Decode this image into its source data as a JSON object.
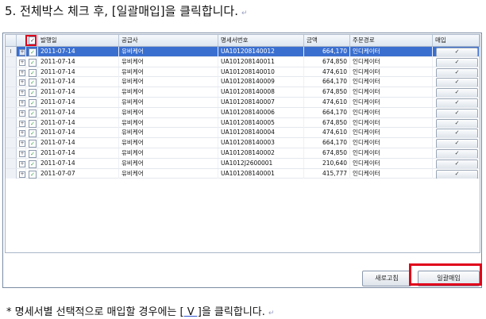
{
  "heading": {
    "text": "5. 전체박스 체크 후, [일괄매입]을 클릭합니다.",
    "mark": "↵"
  },
  "grid": {
    "columns": [
      "",
      "",
      "✓",
      "발행일",
      "공급사",
      "명세서번호",
      "금액",
      "주문경로",
      "매입"
    ],
    "rows": [
      {
        "indicator": "I",
        "expand": "+",
        "check": "✓",
        "date": "2011-07-14",
        "supplier": "유비케어",
        "statement": "UA101208140012",
        "amount": "664,170",
        "route": "인디케이터",
        "buy": "✓"
      },
      {
        "indicator": "",
        "expand": "+",
        "check": "✓",
        "date": "2011-07-14",
        "supplier": "유비케어",
        "statement": "UA101208140011",
        "amount": "674,850",
        "route": "인디케이터",
        "buy": "✓"
      },
      {
        "indicator": "",
        "expand": "+",
        "check": "✓",
        "date": "2011-07-14",
        "supplier": "유비케어",
        "statement": "UA101208140010",
        "amount": "474,610",
        "route": "인디케이터",
        "buy": "✓"
      },
      {
        "indicator": "",
        "expand": "+",
        "check": "✓",
        "date": "2011-07-14",
        "supplier": "유비케어",
        "statement": "UA101208140009",
        "amount": "664,170",
        "route": "인디케이터",
        "buy": "✓"
      },
      {
        "indicator": "",
        "expand": "+",
        "check": "✓",
        "date": "2011-07-14",
        "supplier": "유비케어",
        "statement": "UA101208140008",
        "amount": "674,850",
        "route": "인디케이터",
        "buy": "✓"
      },
      {
        "indicator": "",
        "expand": "+",
        "check": "✓",
        "date": "2011-07-14",
        "supplier": "유비케어",
        "statement": "UA101208140007",
        "amount": "474,610",
        "route": "인디케이터",
        "buy": "✓"
      },
      {
        "indicator": "",
        "expand": "+",
        "check": "✓",
        "date": "2011-07-14",
        "supplier": "유비케어",
        "statement": "UA101208140006",
        "amount": "664,170",
        "route": "인디케이터",
        "buy": "✓"
      },
      {
        "indicator": "",
        "expand": "+",
        "check": "✓",
        "date": "2011-07-14",
        "supplier": "유비케어",
        "statement": "UA101208140005",
        "amount": "674,850",
        "route": "인디케이터",
        "buy": "✓"
      },
      {
        "indicator": "",
        "expand": "+",
        "check": "✓",
        "date": "2011-07-14",
        "supplier": "유비케어",
        "statement": "UA101208140004",
        "amount": "474,610",
        "route": "인디케이터",
        "buy": "✓"
      },
      {
        "indicator": "",
        "expand": "+",
        "check": "✓",
        "date": "2011-07-14",
        "supplier": "유비케어",
        "statement": "UA101208140003",
        "amount": "664,170",
        "route": "인디케이터",
        "buy": "✓"
      },
      {
        "indicator": "",
        "expand": "+",
        "check": "✓",
        "date": "2011-07-14",
        "supplier": "유비케어",
        "statement": "UA101208140002",
        "amount": "674,850",
        "route": "인디케이터",
        "buy": "✓"
      },
      {
        "indicator": "",
        "expand": "+",
        "check": "✓",
        "date": "2011-07-14",
        "supplier": "유비케어",
        "statement": "UA1012J2600001",
        "amount": "210,640",
        "route": "인디케이터",
        "buy": "✓"
      },
      {
        "indicator": "",
        "expand": "+",
        "check": "✓",
        "date": "2011-07-07",
        "supplier": "유비케어",
        "statement": "UA101208140001",
        "amount": "415,777",
        "route": "인디케이터",
        "buy": "✓"
      }
    ]
  },
  "buttons": {
    "refresh": "새로고침",
    "bulk_purchase": "일괄매입"
  },
  "footnote": {
    "prefix": "* 명세서별 선택적으로 매입할 경우에는 ",
    "key": "[ V ]",
    "suffix": "을 클릭합니다.",
    "mark": "↵"
  },
  "colors": {
    "highlight": "#e0001a",
    "selected_row": "#3a6fd0"
  }
}
